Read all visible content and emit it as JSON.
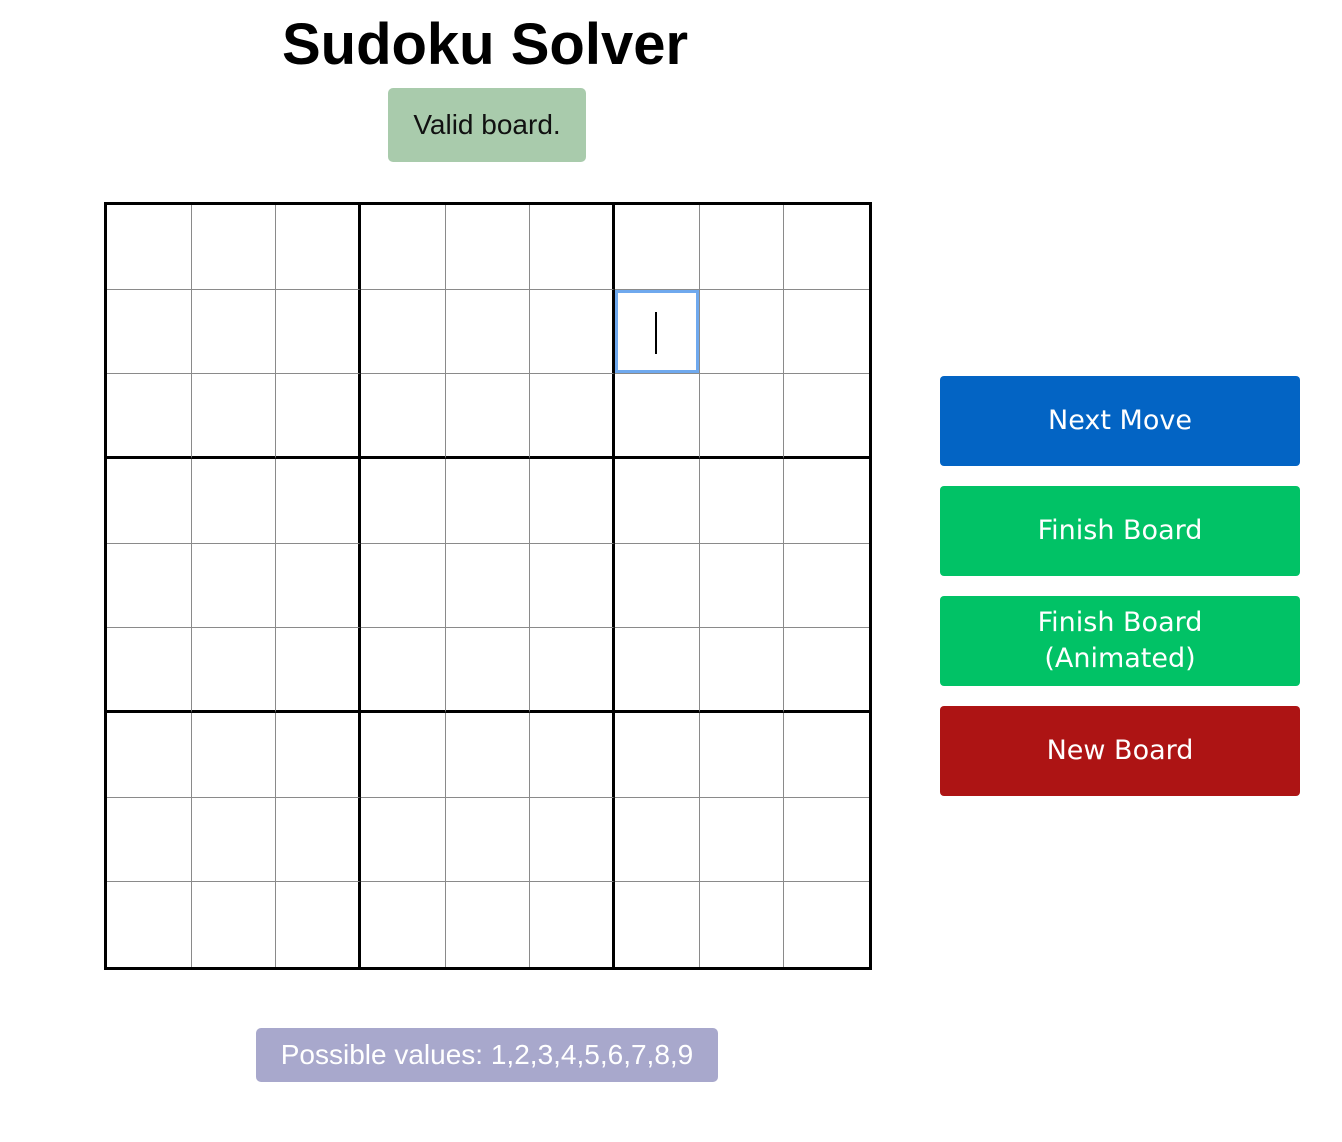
{
  "title": "Sudoku Solver",
  "status": {
    "text": "Valid board.",
    "color": "#a9cbac"
  },
  "board": {
    "rows": 9,
    "cols": 9,
    "cells": [
      [
        "",
        "",
        "",
        "",
        "",
        "",
        "",
        "",
        ""
      ],
      [
        "",
        "",
        "",
        "",
        "",
        "",
        "",
        "",
        ""
      ],
      [
        "",
        "",
        "",
        "",
        "",
        "",
        "",
        "",
        ""
      ],
      [
        "",
        "",
        "",
        "",
        "",
        "",
        "",
        "",
        ""
      ],
      [
        "",
        "",
        "",
        "",
        "",
        "",
        "",
        "",
        ""
      ],
      [
        "",
        "",
        "",
        "",
        "",
        "",
        "",
        "",
        ""
      ],
      [
        "",
        "",
        "",
        "",
        "",
        "",
        "",
        "",
        ""
      ],
      [
        "",
        "",
        "",
        "",
        "",
        "",
        "",
        "",
        ""
      ],
      [
        "",
        "",
        "",
        "",
        "",
        "",
        "",
        "",
        ""
      ]
    ],
    "selected": {
      "row": 2,
      "col": 7
    }
  },
  "buttons": {
    "next_move": {
      "label": "Next Move",
      "color": "#0364c4"
    },
    "finish_board": {
      "label": "Finish Board",
      "color": "#01c266"
    },
    "finish_board_animated": {
      "label": "Finish Board (Animated)",
      "color": "#01c266"
    },
    "new_board": {
      "label": "New Board",
      "color": "#ad1414"
    }
  },
  "possible_values": {
    "text": "Possible values: 1,2,3,4,5,6,7,8,9",
    "color": "#a8a8cc"
  }
}
